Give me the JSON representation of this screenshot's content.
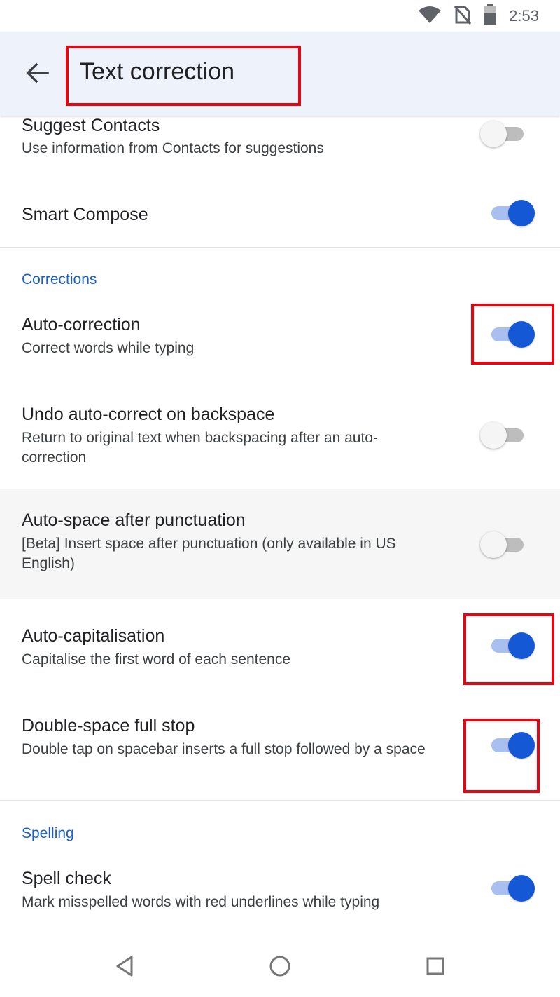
{
  "status_bar": {
    "time": "2:53",
    "icons": [
      "wifi-icon",
      "no-sim-icon",
      "battery-icon"
    ]
  },
  "app_bar": {
    "title": "Text correction",
    "back_icon": "arrow-back-icon"
  },
  "settings": {
    "suggest_contacts": {
      "title": "Suggest Contacts",
      "subtitle": "Use information from Contacts for suggestions",
      "enabled": false
    },
    "smart_compose": {
      "title": "Smart Compose",
      "enabled": true
    },
    "corrections_header": "Corrections",
    "auto_correction": {
      "title": "Auto-correction",
      "subtitle": "Correct words while typing",
      "enabled": true
    },
    "undo_autocorrect": {
      "title": "Undo auto-correct on backspace",
      "subtitle": "Return to original text when backspacing after an auto-correction",
      "enabled": false
    },
    "auto_space": {
      "title": "Auto-space after punctuation",
      "subtitle": "[Beta] Insert space after punctuation (only available in US English)",
      "enabled": false
    },
    "auto_capitalisation": {
      "title": "Auto-capitalisation",
      "subtitle": "Capitalise the first word of each sentence",
      "enabled": true
    },
    "double_space": {
      "title": "Double-space full stop",
      "subtitle": "Double tap on spacebar inserts a full stop followed by a space",
      "enabled": true
    },
    "spelling_header": "Spelling",
    "spell_check": {
      "title": "Spell check",
      "subtitle": "Mark misspelled words with red underlines while typing",
      "enabled": true
    }
  },
  "nav_bar": {
    "back": "nav-back-icon",
    "home": "nav-home-icon",
    "recents": "nav-recents-icon"
  },
  "colors": {
    "accent": "#1558d6",
    "app_bar_bg": "#eef2fb",
    "highlight_box": "#e30613",
    "section_header": "#1a5fc7"
  }
}
